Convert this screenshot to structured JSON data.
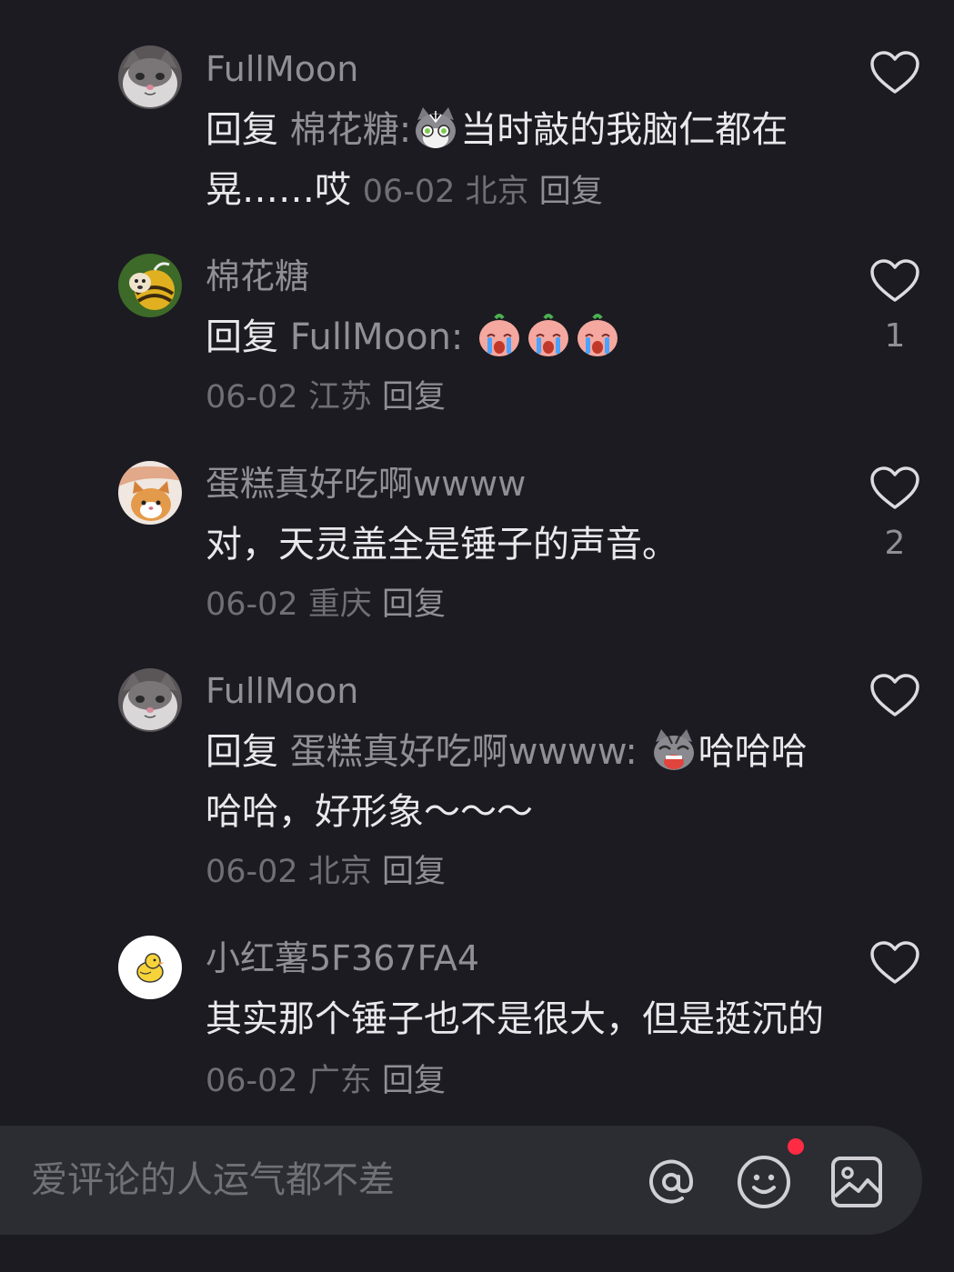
{
  "comments": [
    {
      "username": "FullMoon",
      "reply_word": "回复",
      "mention": "棉花糖:",
      "text_after_emoji": "当时敲的我脑仁都在晃……哎",
      "date": "06-02",
      "location": "北京",
      "reply_link": "回复",
      "likes": ""
    },
    {
      "username": "棉花糖",
      "reply_word": "回复",
      "mention": "FullMoon:",
      "date": "06-02",
      "location": "江苏",
      "reply_link": "回复",
      "likes": "1"
    },
    {
      "username": "蛋糕真好吃啊wwww",
      "text": "对，天灵盖全是锤子的声音。",
      "date": "06-02",
      "location": "重庆",
      "reply_link": "回复",
      "likes": "2"
    },
    {
      "username": "FullMoon",
      "reply_word": "回复",
      "mention": "蛋糕真好吃啊wwww:",
      "text_after_emoji": "哈哈哈哈哈，好形象～～～",
      "date": "06-02",
      "location": "北京",
      "reply_link": "回复",
      "likes": ""
    },
    {
      "username": "小红薯5F367FA4",
      "text": "其实那个锤子也不是很大，但是挺沉的",
      "date": "06-02",
      "location": "广东",
      "reply_link": "回复",
      "likes": ""
    }
  ],
  "input_bar": {
    "placeholder": "爱评论的人运气都不差",
    "icons": [
      "at-icon",
      "emoji-icon",
      "image-icon"
    ],
    "has_notification_dot": true
  },
  "colors": {
    "background": "#1b1b21",
    "input_bar": "#2c2c33",
    "primary_text": "#e9e9ec",
    "secondary_text": "#8f8f95",
    "notification": "#ff2a43"
  }
}
